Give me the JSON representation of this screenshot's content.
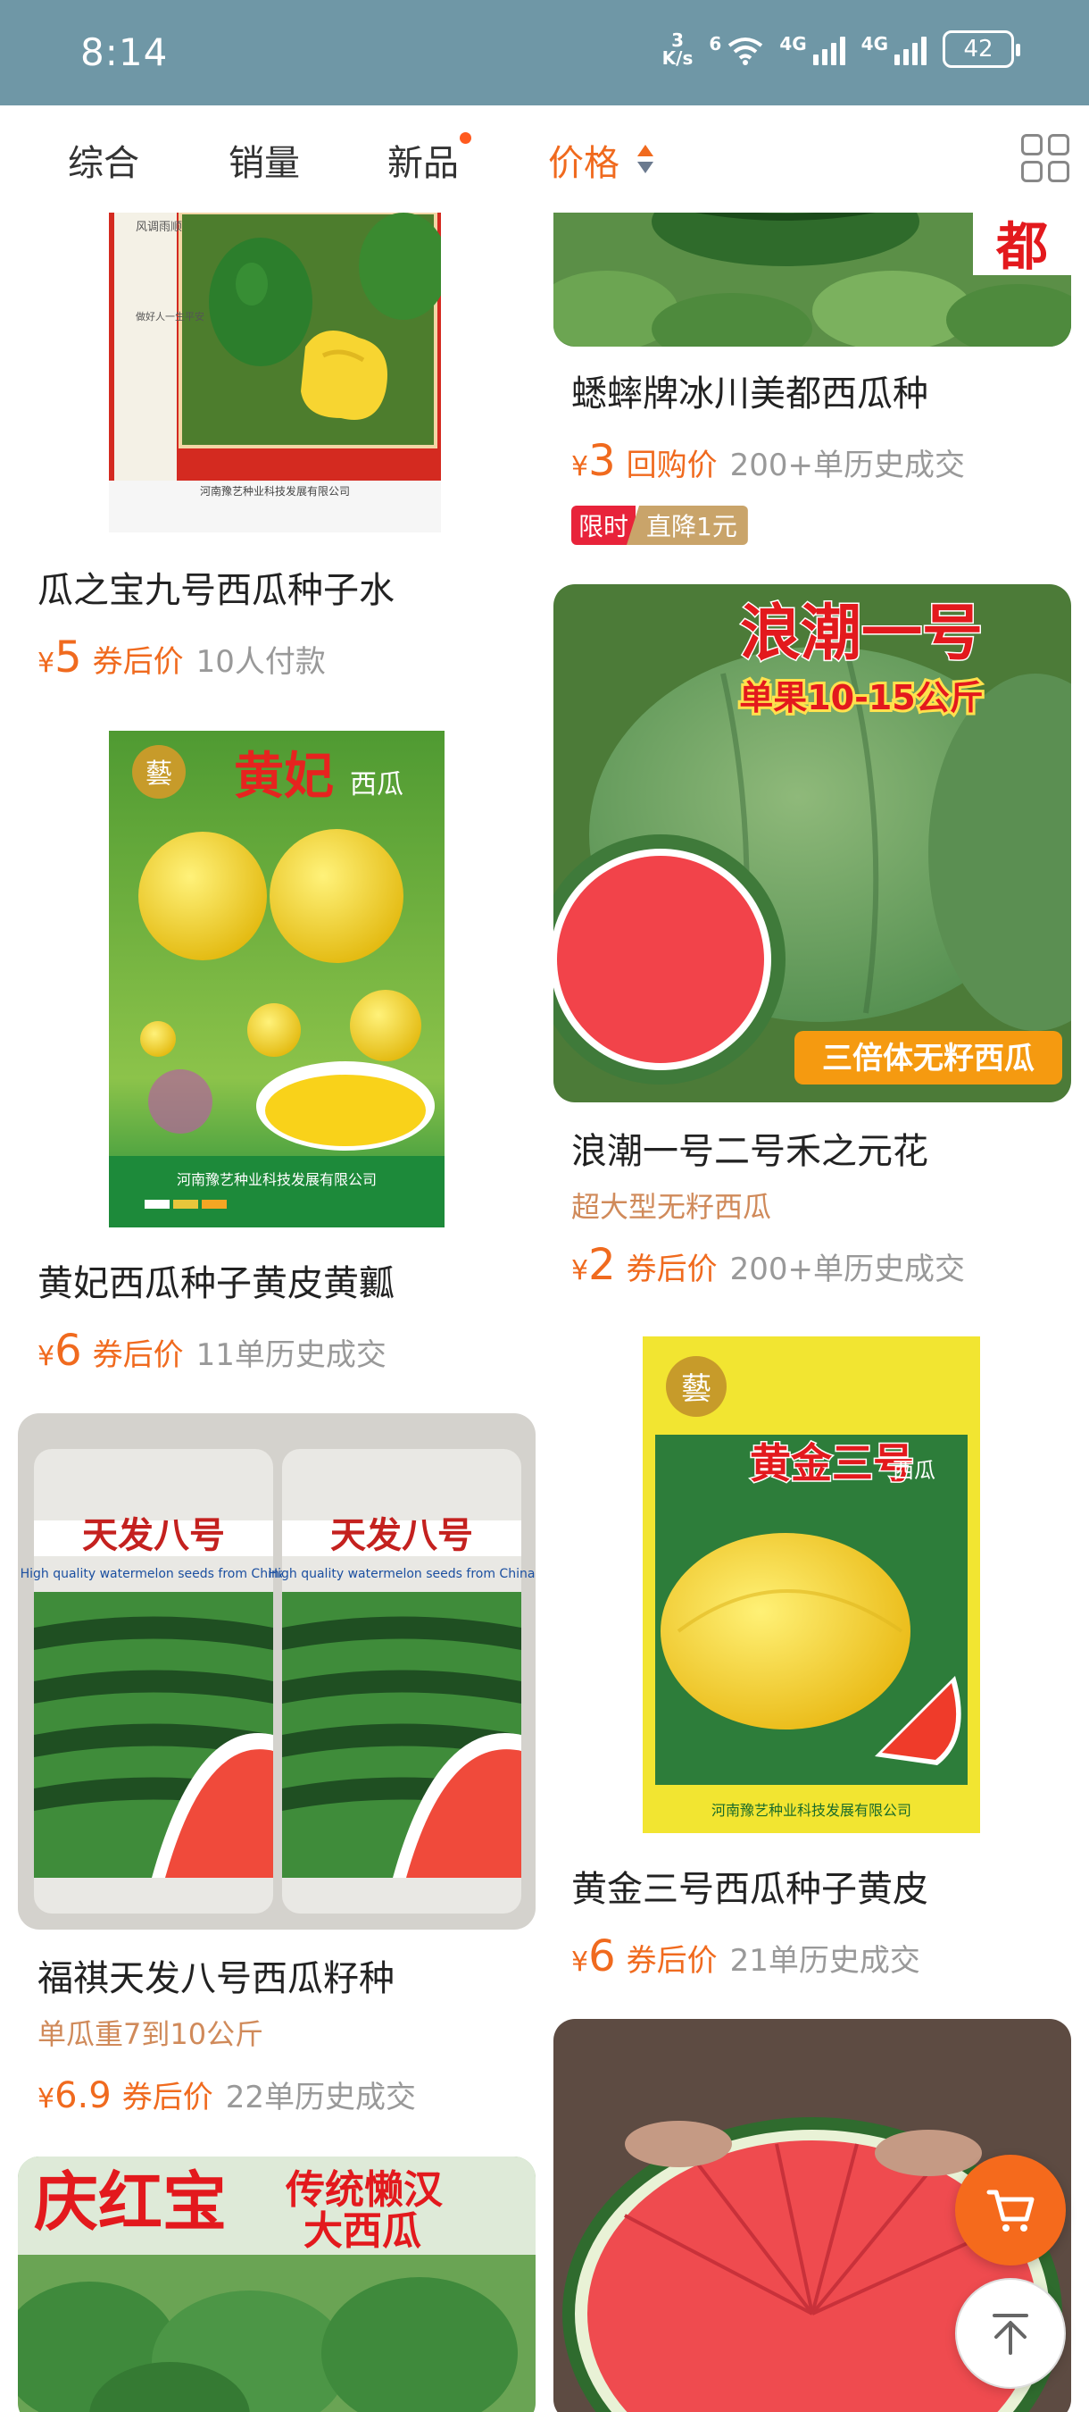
{
  "status_bar": {
    "time": "8:14",
    "net_speed_value": "3",
    "net_speed_unit": "K/s",
    "wifi_label": "6",
    "signal1_label": "4G",
    "signal2_label": "4G",
    "battery": "42"
  },
  "filters": {
    "tabs": [
      "综合",
      "销量",
      "新品",
      "价格"
    ],
    "active": "价格",
    "accent_color": "#f06a1e"
  },
  "products": [
    {
      "title": "瓜之宝九号西瓜种子水",
      "currency": "¥",
      "price": "5",
      "price_tag": "券后价",
      "sales": "10人付款",
      "image_text": [
        "风调雨顺",
        "做好人一生平安",
        "河南豫艺种业科技发展有限公司"
      ]
    },
    {
      "title": "黄妃西瓜种子黄皮黄瓤",
      "currency": "¥",
      "price": "6",
      "price_tag": "券后价",
      "sales": "11单历史成交",
      "image_text": [
        "藝",
        "黄妃",
        "西瓜",
        "河南豫艺种业科技发展有限公司"
      ]
    },
    {
      "title": "福祺天发八号西瓜籽种",
      "subtitle": "单瓜重7到10公斤",
      "currency": "¥",
      "price": "6.9",
      "price_tag": "券后价",
      "sales": "22单历史成交",
      "image_text": [
        "天发八号",
        "High quality watermelon seeds from China"
      ]
    },
    {
      "title": "庆红宝传统懒汉大西瓜",
      "image_text": [
        "庆红宝",
        "传统懒汉",
        "大西瓜"
      ]
    },
    {
      "title": "蟋蟀牌冰川美都西瓜种",
      "currency": "¥",
      "price": "3",
      "price_tag": "回购价",
      "sales": "200+单历史成交",
      "promo_a": "限时",
      "promo_b": "直降1元",
      "image_text": [
        "都"
      ]
    },
    {
      "title": "浪潮一号二号禾之元花",
      "subtitle": "超大型无籽西瓜",
      "currency": "¥",
      "price": "2",
      "price_tag": "券后价",
      "sales": "200+单历史成交",
      "image_text": [
        "浪潮一号",
        "单果10-15公斤",
        "三倍体无籽西瓜"
      ]
    },
    {
      "title": "黄金三号西瓜种子黄皮",
      "currency": "¥",
      "price": "6",
      "price_tag": "券后价",
      "sales": "21单历史成交",
      "image_text": [
        "藝",
        "黄金三号",
        "西瓜",
        "河南豫艺种业科技发展有限公司"
      ]
    }
  ]
}
